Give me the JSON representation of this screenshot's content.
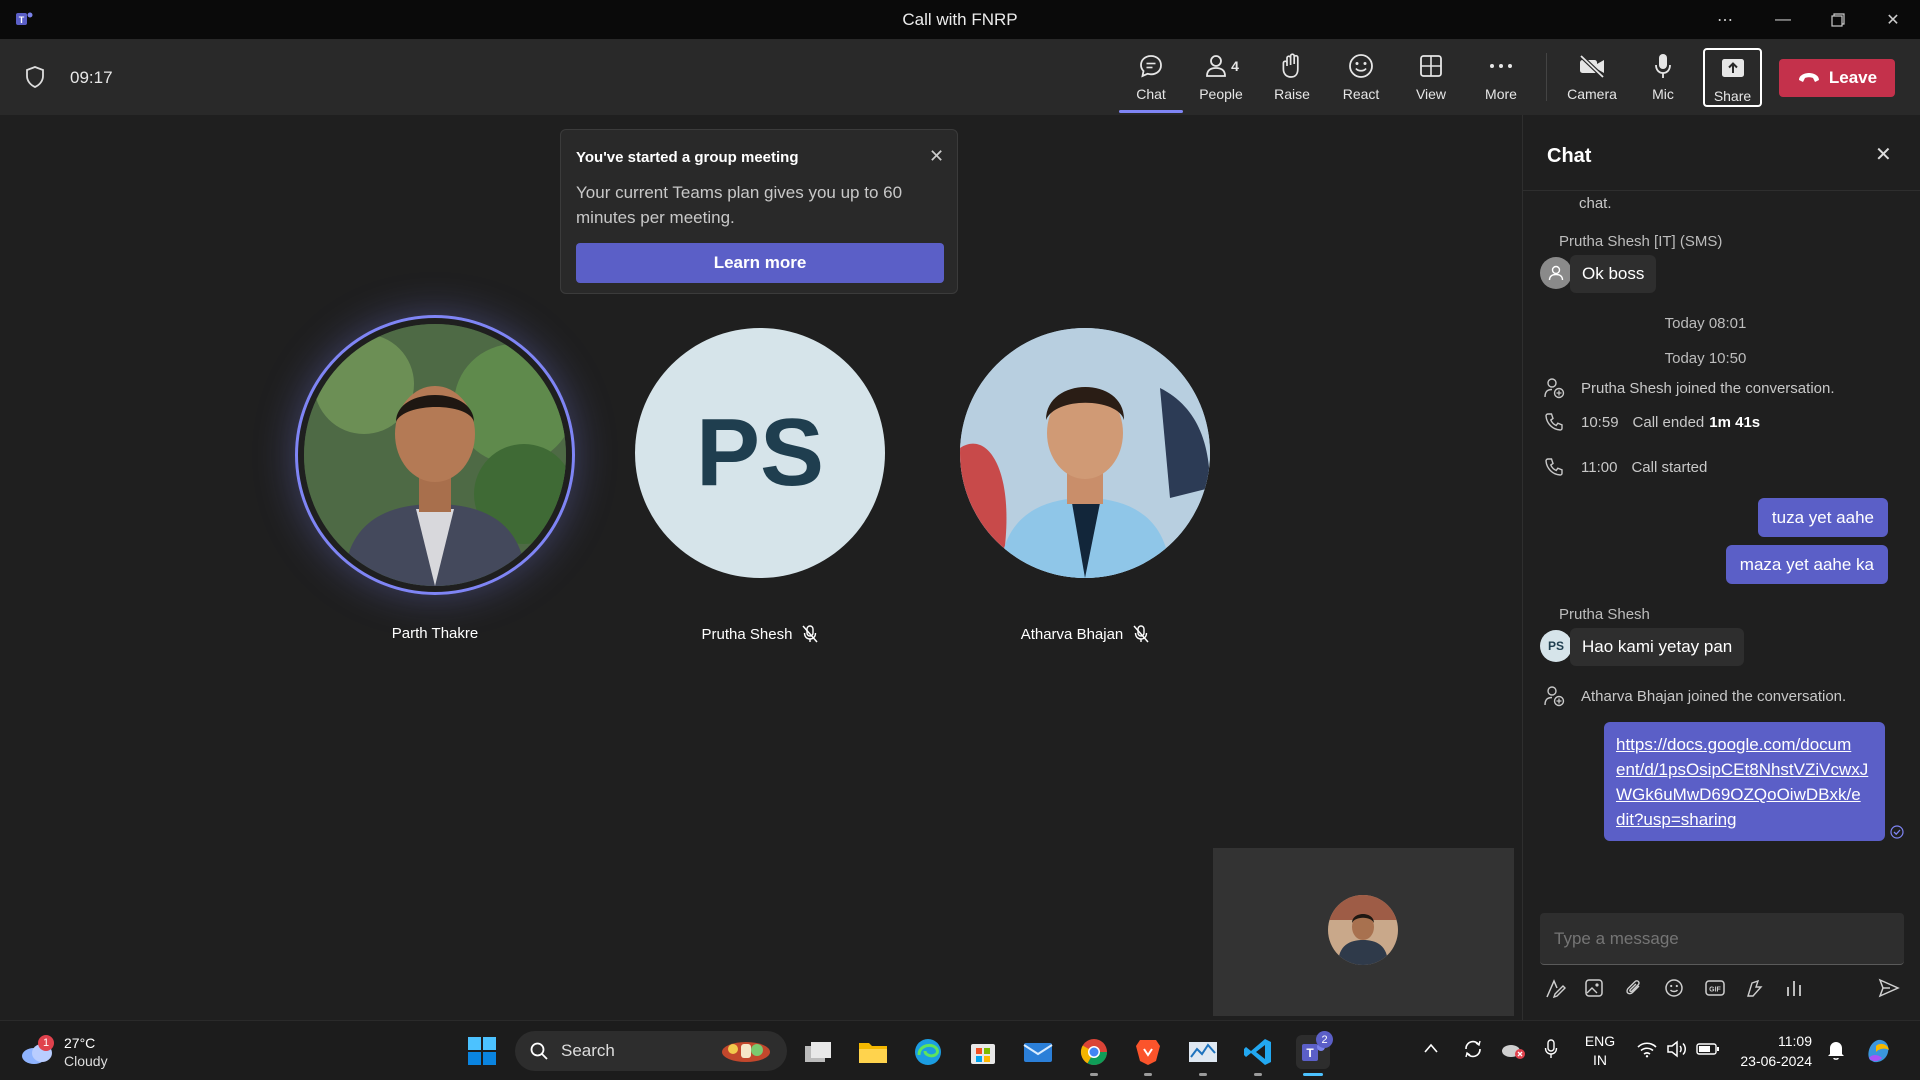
{
  "window": {
    "title": "Call with FNRP"
  },
  "toolbar": {
    "timer": "09:17",
    "items": [
      {
        "label": "Chat",
        "icon": "chat-icon"
      },
      {
        "label": "People",
        "icon": "people-icon",
        "count": "4"
      },
      {
        "label": "Raise",
        "icon": "hand-icon"
      },
      {
        "label": "React",
        "icon": "smile-icon"
      },
      {
        "label": "View",
        "icon": "grid-icon"
      },
      {
        "label": "More",
        "icon": "more-icon"
      },
      {
        "label": "Camera",
        "icon": "camera-off-icon"
      },
      {
        "label": "Mic",
        "icon": "mic-icon"
      },
      {
        "label": "Share",
        "icon": "share-icon"
      }
    ],
    "leave_label": "Leave"
  },
  "notice": {
    "title": "You've started a group meeting",
    "body": "Your current Teams plan gives you up to 60 minutes per meeting.",
    "button": "Learn more"
  },
  "participants": [
    {
      "name": "Parth Thakre",
      "muted": false,
      "speaking": true
    },
    {
      "name": "Prutha Shesh",
      "initials": "PS",
      "muted": true
    },
    {
      "name": "Atharva Bhajan",
      "muted": true
    }
  ],
  "chat": {
    "title": "Chat",
    "top_fragment": "chat.",
    "sender1": "Prutha Shesh [IT] (SMS)",
    "msg1": "Ok boss",
    "time1": "Today 08:01",
    "time2": "Today 10:50",
    "sys1": "Prutha Shesh joined the conversation.",
    "call_end_time": "10:59",
    "call_end_text": "Call ended",
    "call_end_duration": "1m 41s",
    "call_start_time": "11:00",
    "call_start_text": "Call started",
    "out1": "tuza yet aahe",
    "out2": "maza yet aahe ka",
    "sender2": "Prutha Shesh",
    "sender2_initials": "PS",
    "msg2": "Hao kami yetay pan",
    "sys2": "Atharva Bhajan joined the conversation.",
    "link_lines": [
      "https://docs.google.com/docum",
      "ent/d/1psOsipCEt8NhstVZiVcwxJ",
      "WGk6uMwD69OZQoOiwDBxk/e",
      "dit?usp=sharing"
    ],
    "input_placeholder": "Type a message"
  },
  "taskbar": {
    "temp": "27°C",
    "weather": "Cloudy",
    "weather_badge": "1",
    "search_label": "Search",
    "teams_badge": "2",
    "lang1": "ENG",
    "lang2": "IN",
    "time": "11:09",
    "date": "23-06-2024"
  },
  "colors": {
    "accent": "#5b5fc7",
    "leave": "#c4314b",
    "speaking_ring": "#7f85f5"
  }
}
